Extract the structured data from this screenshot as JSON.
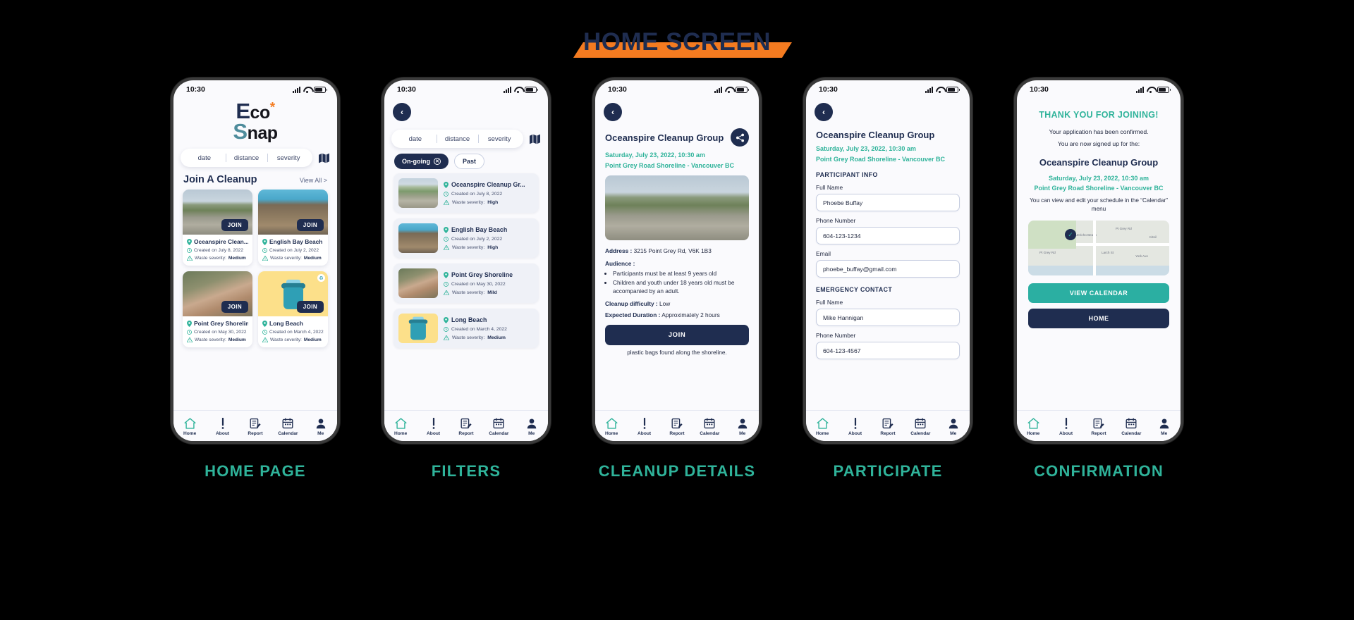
{
  "page": {
    "title": "HOME SCREEN",
    "banner_color": "#F47B20",
    "title_color": "#1F2D50"
  },
  "colors": {
    "navy": "#1F2D50",
    "teal": "#2FB39A",
    "orange": "#F47B20",
    "screen_bg": "#FAFAFD"
  },
  "statusbar": {
    "time": "10:30"
  },
  "nav": {
    "items": [
      {
        "label": "Home",
        "icon": "home-icon"
      },
      {
        "label": "About",
        "icon": "exclamation-icon"
      },
      {
        "label": "Report",
        "icon": "report-icon"
      },
      {
        "label": "Calendar",
        "icon": "calendar-icon"
      },
      {
        "label": "Me",
        "icon": "person-icon"
      }
    ]
  },
  "screens": [
    {
      "caption": "HOME PAGE",
      "logo": {
        "line1_cap": "E",
        "line1_rest": "co",
        "asterisk": "*",
        "line2_cap": "S",
        "line2_rest": "nap"
      },
      "filters": {
        "options": [
          "date",
          "distance",
          "severity"
        ],
        "map_icon": "map-icon"
      },
      "section": {
        "title": "Join A Cleanup",
        "link": "View All >"
      },
      "cards": [
        {
          "title": "Oceanspire Clean...",
          "created": "Created on July 8, 2022",
          "severity_label": "Waste severity:",
          "severity": "Medium",
          "join": "JOIN",
          "photo": "ph-shore"
        },
        {
          "title": "English Bay Beach",
          "created": "Created on July 2, 2022",
          "severity_label": "Waste severity:",
          "severity": "Medium",
          "join": "JOIN",
          "photo": "ph-volunteer"
        },
        {
          "title": "Point Grey Shoreline",
          "created": "Created on May 30, 2022",
          "severity_label": "Waste severity:",
          "severity": "Medium",
          "join": "JOIN",
          "photo": "ph-hands"
        },
        {
          "title": "Long Beach",
          "created": "Created on March 4, 2022",
          "severity_label": "Waste severity:",
          "severity": "Medium",
          "join": "JOIN",
          "photo": "ph-yellow"
        }
      ]
    },
    {
      "caption": "FILTERS",
      "back": "‹",
      "filters": {
        "options": [
          "date",
          "distance",
          "severity"
        ],
        "map_icon": "map-icon"
      },
      "pills": [
        {
          "label": "On-going",
          "active": true,
          "close_icon": "close-circle-icon"
        },
        {
          "label": "Past",
          "active": false
        }
      ],
      "rows": [
        {
          "title": "Oceanspire Cleanup Gr...",
          "created": "Created on July 8, 2022",
          "severity_label": "Waste severity:",
          "severity": "High",
          "photo": "ph-beach"
        },
        {
          "title": "English Bay Beach",
          "created": "Created on July 2, 2022",
          "severity_label": "Waste severity:",
          "severity": "High",
          "photo": "ph-volunteer"
        },
        {
          "title": "Point Grey Shoreline",
          "created": "Created on May 30, 2022",
          "severity_label": "Waste severity:",
          "severity": "Mild",
          "photo": "ph-hands"
        },
        {
          "title": "Long Beach",
          "created": "Created on March 4, 2022",
          "severity_label": "Waste severity:",
          "severity": "Medium",
          "photo": "ph-long"
        }
      ]
    },
    {
      "caption": "CLEANUP DETAILS",
      "back": "‹",
      "title": "Oceanspire Cleanup Group",
      "share_icon": "share-icon",
      "datetime": "Saturday, July 23, 2022, 10:30 am",
      "location": "Point Grey Road Shoreline - Vancouver BC",
      "photo": "ph-shore",
      "address_label": "Address :",
      "address": "3215 Point Grey Rd, V6K 1B3",
      "audience_label": "Audience :",
      "audience_items": [
        "Participants must be at least 9 years old",
        "Children and youth under 18 years old must be accompanied by an adult."
      ],
      "difficulty_label": "Cleanup difficulty :",
      "difficulty": "Low",
      "duration_label": "Expected Duration :",
      "duration": "Approximately 2 hours",
      "join": "JOIN",
      "trailing_text": "plastic bags found along the shoreline."
    },
    {
      "caption": "PARTICIPATE",
      "back": "‹",
      "title": "Oceanspire Cleanup Group",
      "datetime": "Saturday, July 23, 2022, 10:30 am",
      "location": "Point Grey Road Shoreline - Vancouver BC",
      "sections": [
        {
          "heading": "PARTICIPANT INFO",
          "fields": [
            {
              "label": "Full Name",
              "value": "Phoebe Buffay"
            },
            {
              "label": "Phone Number",
              "value": "604-123-1234"
            },
            {
              "label": "Email",
              "value": "phoebe_buffay@gmail.com"
            }
          ]
        },
        {
          "heading": "EMERGENCY CONTACT",
          "fields": [
            {
              "label": "Full Name",
              "value": "Mike Hannigan"
            },
            {
              "label": "Phone Number",
              "value": "604-123-4567"
            }
          ]
        }
      ]
    },
    {
      "caption": "CONFIRMATION",
      "heading": "THANK YOU FOR JOINING!",
      "line1": "Your application has been confirmed.",
      "line2": "You are now signed up for the:",
      "group": "Oceanspire Cleanup Group",
      "datetime": "Saturday, July 23, 2022, 10:30 am",
      "location": "Point Grey Road Shoreline - Vancouver BC",
      "note": "You can view and edit your schedule in the “Calendar” menu",
      "map": {
        "marker_icon": "check-pin-icon",
        "labels": [
          "Jericho Beach",
          "Pt Grey Rd",
          "Pt Grey Rd",
          "Larch St",
          "York Ave",
          "Kitsil"
        ]
      },
      "buttons": [
        {
          "label": "VIEW CALENDAR",
          "style": "teal"
        },
        {
          "label": "HOME",
          "style": "navy"
        }
      ]
    }
  ]
}
